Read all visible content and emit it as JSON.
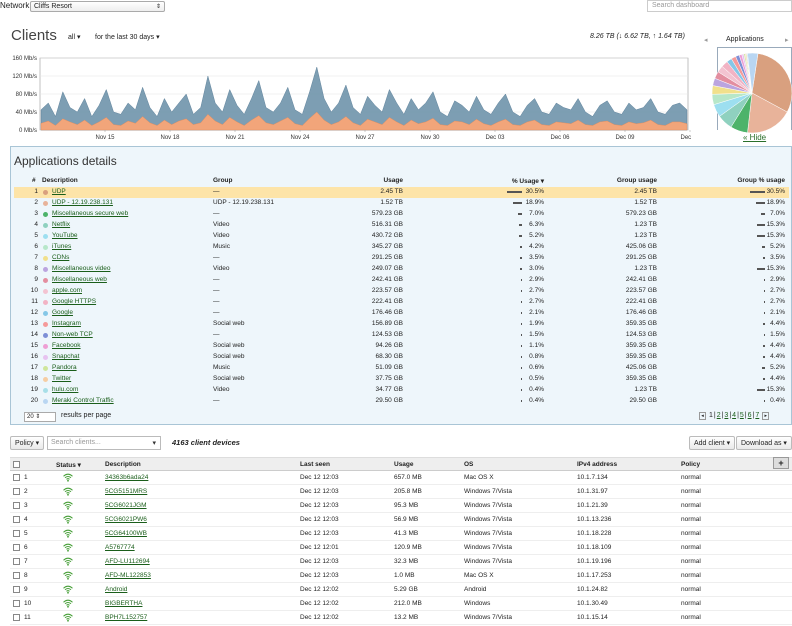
{
  "network": {
    "label": "Network:",
    "selected": "Cliffs Resort"
  },
  "search": {
    "placeholder": "Search dashboard"
  },
  "clients_header": {
    "title": "Clients",
    "filter_all": "all",
    "filter_period": "for the last 30 days",
    "totals": "8.26 TB (↓ 6.62 TB, ↑ 1.64 TB)"
  },
  "chart_data": {
    "type": "area",
    "y_ticks": [
      "160 Mb/s",
      "120 Mb/s",
      "80 Mb/s",
      "40 Mb/s",
      "0 Mb/s"
    ],
    "ylim": [
      0,
      160
    ],
    "x_ticks": [
      "Nov 15",
      "Nov 18",
      "Nov 21",
      "Nov 24",
      "Nov 27",
      "Nov 30",
      "Dec 03",
      "Dec 06",
      "Dec 09",
      "Dec 12"
    ],
    "series": [
      {
        "name": "",
        "color": "#6f93ab",
        "values": [
          45,
          60,
          30,
          85,
          50,
          40,
          70,
          30,
          55,
          90,
          40,
          35,
          60,
          45,
          95,
          50,
          30,
          70,
          40,
          60,
          80,
          35,
          50,
          120,
          60,
          40,
          90,
          55,
          35,
          70,
          110,
          50,
          40,
          60,
          95,
          45,
          35,
          85,
          140,
          70,
          40,
          60,
          100,
          50,
          35,
          75,
          55,
          40,
          90,
          60,
          35,
          70,
          45,
          60,
          85,
          40,
          30,
          65,
          55,
          40,
          75,
          45,
          35,
          60,
          80,
          40,
          30,
          55,
          70,
          40,
          35,
          60,
          50,
          45,
          70,
          40,
          30,
          55,
          65,
          40,
          35,
          60,
          45,
          50,
          70,
          40,
          35,
          55,
          60,
          45
        ]
      },
      {
        "name": "",
        "color": "#f2a57a",
        "values": [
          15,
          20,
          10,
          25,
          18,
          12,
          22,
          10,
          18,
          28,
          12,
          10,
          20,
          15,
          30,
          16,
          10,
          22,
          12,
          20,
          25,
          12,
          16,
          35,
          20,
          12,
          28,
          18,
          10,
          22,
          32,
          16,
          12,
          20,
          28,
          14,
          10,
          26,
          40,
          22,
          12,
          18,
          30,
          16,
          10,
          24,
          18,
          12,
          28,
          18,
          10,
          22,
          14,
          18,
          26,
          12,
          10,
          20,
          18,
          12,
          24,
          14,
          10,
          18,
          24,
          12,
          10,
          18,
          22,
          12,
          10,
          18,
          16,
          14,
          22,
          12,
          10,
          18,
          20,
          12,
          10,
          18,
          14,
          16,
          22,
          12,
          10,
          18,
          18,
          14
        ]
      }
    ]
  },
  "apps_panel": {
    "title": "Applications",
    "hide_label": "« Hide",
    "prev": "◂",
    "next": "▸",
    "slices": [
      {
        "value": 30.5,
        "color": "#d9a07f"
      },
      {
        "value": 18.9,
        "color": "#e8b39a"
      },
      {
        "value": 7.0,
        "color": "#4db36a"
      },
      {
        "value": 6.3,
        "color": "#8fd1bf"
      },
      {
        "value": 5.2,
        "color": "#9ddff0"
      },
      {
        "value": 4.2,
        "color": "#b7e7c9"
      },
      {
        "value": 3.5,
        "color": "#f1e08c"
      },
      {
        "value": 3.0,
        "color": "#bba4df"
      },
      {
        "value": 2.9,
        "color": "#e38ea0"
      },
      {
        "value": 2.7,
        "color": "#f3c3d1"
      },
      {
        "value": 2.7,
        "color": "#f2b3c4"
      },
      {
        "value": 2.1,
        "color": "#85c7e7"
      },
      {
        "value": 1.9,
        "color": "#f59a9a"
      },
      {
        "value": 1.5,
        "color": "#7d8fd6"
      },
      {
        "value": 1.1,
        "color": "#ee9fd4"
      },
      {
        "value": 0.8,
        "color": "#e7c3f0"
      },
      {
        "value": 0.6,
        "color": "#cfe69b"
      },
      {
        "value": 0.5,
        "color": "#f6cda3"
      },
      {
        "value": 0.4,
        "color": "#a8dfe8"
      },
      {
        "value": 4.2,
        "color": "#b9d6f2"
      }
    ]
  },
  "applications_details": {
    "title": "Applications details",
    "columns": {
      "num": "#",
      "description": "Description",
      "group": "Group",
      "usage": "Usage",
      "pct_usage": "% Usage ▾",
      "group_usage": "Group usage",
      "group_pct": "Group % usage"
    },
    "rows": [
      {
        "n": "1",
        "desc": "UDP",
        "color": "#d9a07f",
        "group": "—",
        "usage": "2.45 TB",
        "pct": "30.5%",
        "pctv": 30.5,
        "gusage": "2.45 TB",
        "gpct": "30.5%",
        "gpctv": 30.5
      },
      {
        "n": "2",
        "desc": "UDP - 12.19.238.131",
        "color": "#e8b39a",
        "group": "UDP - 12.19.238.131",
        "usage": "1.52 TB",
        "pct": "18.9%",
        "pctv": 18.9,
        "gusage": "1.52 TB",
        "gpct": "18.9%",
        "gpctv": 18.9
      },
      {
        "n": "3",
        "desc": "Miscellaneous secure web",
        "color": "#4db36a",
        "group": "—",
        "usage": "579.23 GB",
        "pct": "7.0%",
        "pctv": 7.0,
        "gusage": "579.23 GB",
        "gpct": "7.0%",
        "gpctv": 7.0
      },
      {
        "n": "4",
        "desc": "Netflix",
        "color": "#8fd1bf",
        "group": "Video",
        "usage": "516.31 GB",
        "pct": "6.3%",
        "pctv": 6.3,
        "gusage": "1.23 TB",
        "gpct": "15.3%",
        "gpctv": 15.3
      },
      {
        "n": "5",
        "desc": "YouTube",
        "color": "#9ddff0",
        "group": "Video",
        "usage": "430.72 GB",
        "pct": "5.2%",
        "pctv": 5.2,
        "gusage": "1.23 TB",
        "gpct": "15.3%",
        "gpctv": 15.3
      },
      {
        "n": "6",
        "desc": "iTunes",
        "color": "#b7e7c9",
        "group": "Music",
        "usage": "345.27 GB",
        "pct": "4.2%",
        "pctv": 4.2,
        "gusage": "425.06 GB",
        "gpct": "5.2%",
        "gpctv": 5.2
      },
      {
        "n": "7",
        "desc": "CDNs",
        "color": "#f1e08c",
        "group": "—",
        "usage": "291.25 GB",
        "pct": "3.5%",
        "pctv": 3.5,
        "gusage": "291.25 GB",
        "gpct": "3.5%",
        "gpctv": 3.5
      },
      {
        "n": "8",
        "desc": "Miscellaneous video",
        "color": "#bba4df",
        "group": "Video",
        "usage": "249.07 GB",
        "pct": "3.0%",
        "pctv": 3.0,
        "gusage": "1.23 TB",
        "gpct": "15.3%",
        "gpctv": 15.3
      },
      {
        "n": "9",
        "desc": "Miscellaneous web",
        "color": "#e38ea0",
        "group": "—",
        "usage": "242.41 GB",
        "pct": "2.9%",
        "pctv": 2.9,
        "gusage": "242.41 GB",
        "gpct": "2.9%",
        "gpctv": 2.9
      },
      {
        "n": "10",
        "desc": "apple.com",
        "color": "#f3c3d1",
        "group": "—",
        "usage": "223.57 GB",
        "pct": "2.7%",
        "pctv": 2.7,
        "gusage": "223.57 GB",
        "gpct": "2.7%",
        "gpctv": 2.7
      },
      {
        "n": "11",
        "desc": "Google HTTPS",
        "color": "#f2b3c4",
        "group": "—",
        "usage": "222.41 GB",
        "pct": "2.7%",
        "pctv": 2.7,
        "gusage": "222.41 GB",
        "gpct": "2.7%",
        "gpctv": 2.7
      },
      {
        "n": "12",
        "desc": "Google",
        "color": "#85c7e7",
        "group": "—",
        "usage": "176.46 GB",
        "pct": "2.1%",
        "pctv": 2.1,
        "gusage": "176.46 GB",
        "gpct": "2.1%",
        "gpctv": 2.1
      },
      {
        "n": "13",
        "desc": "Instagram",
        "color": "#f59a9a",
        "group": "Social web",
        "usage": "156.89 GB",
        "pct": "1.9%",
        "pctv": 1.9,
        "gusage": "359.35 GB",
        "gpct": "4.4%",
        "gpctv": 4.4
      },
      {
        "n": "14",
        "desc": "Non-web TCP",
        "color": "#7d8fd6",
        "group": "—",
        "usage": "124.53 GB",
        "pct": "1.5%",
        "pctv": 1.5,
        "gusage": "124.53 GB",
        "gpct": "1.5%",
        "gpctv": 1.5
      },
      {
        "n": "15",
        "desc": "Facebook",
        "color": "#ee9fd4",
        "group": "Social web",
        "usage": "94.26 GB",
        "pct": "1.1%",
        "pctv": 1.1,
        "gusage": "359.35 GB",
        "gpct": "4.4%",
        "gpctv": 4.4
      },
      {
        "n": "16",
        "desc": "Snapchat",
        "color": "#e7c3f0",
        "group": "Social web",
        "usage": "68.30 GB",
        "pct": "0.8%",
        "pctv": 0.8,
        "gusage": "359.35 GB",
        "gpct": "4.4%",
        "gpctv": 4.4
      },
      {
        "n": "17",
        "desc": "Pandora",
        "color": "#cfe69b",
        "group": "Music",
        "usage": "51.09 GB",
        "pct": "0.6%",
        "pctv": 0.6,
        "gusage": "425.06 GB",
        "gpct": "5.2%",
        "gpctv": 5.2
      },
      {
        "n": "18",
        "desc": "Twitter",
        "color": "#f6cda3",
        "group": "Social web",
        "usage": "37.75 GB",
        "pct": "0.5%",
        "pctv": 0.5,
        "gusage": "359.35 GB",
        "gpct": "4.4%",
        "gpctv": 4.4
      },
      {
        "n": "19",
        "desc": "hulu.com",
        "color": "#a8dfe8",
        "group": "Video",
        "usage": "34.77 GB",
        "pct": "0.4%",
        "pctv": 0.4,
        "gusage": "1.23 TB",
        "gpct": "15.3%",
        "gpctv": 15.3
      },
      {
        "n": "20",
        "desc": "Meraki Control Traffic",
        "color": "#b9d6f2",
        "group": "—",
        "usage": "29.50 GB",
        "pct": "0.4%",
        "pctv": 0.4,
        "gusage": "29.50 GB",
        "gpct": "0.4%",
        "gpctv": 0.4
      }
    ],
    "per_page_value": "20",
    "per_page_label": "results per page",
    "pager": {
      "prev": "◂",
      "pages": [
        "1",
        "2",
        "3",
        "4",
        "5",
        "6",
        "7"
      ],
      "next": "▸"
    }
  },
  "clients_toolbar": {
    "policy_label": "Policy ▾",
    "search_placeholder": "Search clients...",
    "device_count": "4163 client devices",
    "add_client": "Add client ▾",
    "download": "Download as ▾",
    "plus": "+"
  },
  "clients_table": {
    "columns": {
      "status": "Status ▾",
      "description": "Description",
      "last_seen": "Last seen",
      "usage": "Usage",
      "os": "OS",
      "ip": "IPv4 address",
      "policy": "Policy"
    },
    "rows": [
      {
        "n": "1",
        "desc": "34363b6ada24",
        "seen": "Dec 12 12:03",
        "usage": "657.0 MB",
        "os": "Mac OS X",
        "ip": "10.1.7.134",
        "policy": "normal"
      },
      {
        "n": "2",
        "desc": "5CG5151MRS",
        "seen": "Dec 12 12:03",
        "usage": "205.8 MB",
        "os": "Windows 7/Vista",
        "ip": "10.1.31.97",
        "policy": "normal"
      },
      {
        "n": "3",
        "desc": "5CG6021JGM",
        "seen": "Dec 12 12:03",
        "usage": "95.3 MB",
        "os": "Windows 7/Vista",
        "ip": "10.1.21.39",
        "policy": "normal"
      },
      {
        "n": "4",
        "desc": "5CG6021PW6",
        "seen": "Dec 12 12:03",
        "usage": "56.9 MB",
        "os": "Windows 7/Vista",
        "ip": "10.1.13.236",
        "policy": "normal"
      },
      {
        "n": "5",
        "desc": "5CG64100WB",
        "seen": "Dec 12 12:03",
        "usage": "41.3 MB",
        "os": "Windows 7/Vista",
        "ip": "10.1.18.228",
        "policy": "normal"
      },
      {
        "n": "6",
        "desc": "A5767774",
        "seen": "Dec 12 12:01",
        "usage": "120.9 MB",
        "os": "Windows 7/Vista",
        "ip": "10.1.18.109",
        "policy": "normal"
      },
      {
        "n": "7",
        "desc": "AFD-LU112694",
        "seen": "Dec 12 12:03",
        "usage": "32.3 MB",
        "os": "Windows 7/Vista",
        "ip": "10.1.19.196",
        "policy": "normal"
      },
      {
        "n": "8",
        "desc": "AFD-ML122853",
        "seen": "Dec 12 12:03",
        "usage": "1.0 MB",
        "os": "Mac OS X",
        "ip": "10.1.17.253",
        "policy": "normal"
      },
      {
        "n": "9",
        "desc": "Android",
        "seen": "Dec 12 12:02",
        "usage": "5.29 GB",
        "os": "Android",
        "ip": "10.1.24.82",
        "policy": "normal"
      },
      {
        "n": "10",
        "desc": "BIGBERTHA",
        "seen": "Dec 12 12:02",
        "usage": "212.0 MB",
        "os": "Windows",
        "ip": "10.1.30.49",
        "policy": "normal"
      },
      {
        "n": "11",
        "desc": "BPH7L152757",
        "seen": "Dec 12 12:02",
        "usage": "13.2 MB",
        "os": "Windows 7/Vista",
        "ip": "10.1.15.14",
        "policy": "normal"
      }
    ]
  }
}
